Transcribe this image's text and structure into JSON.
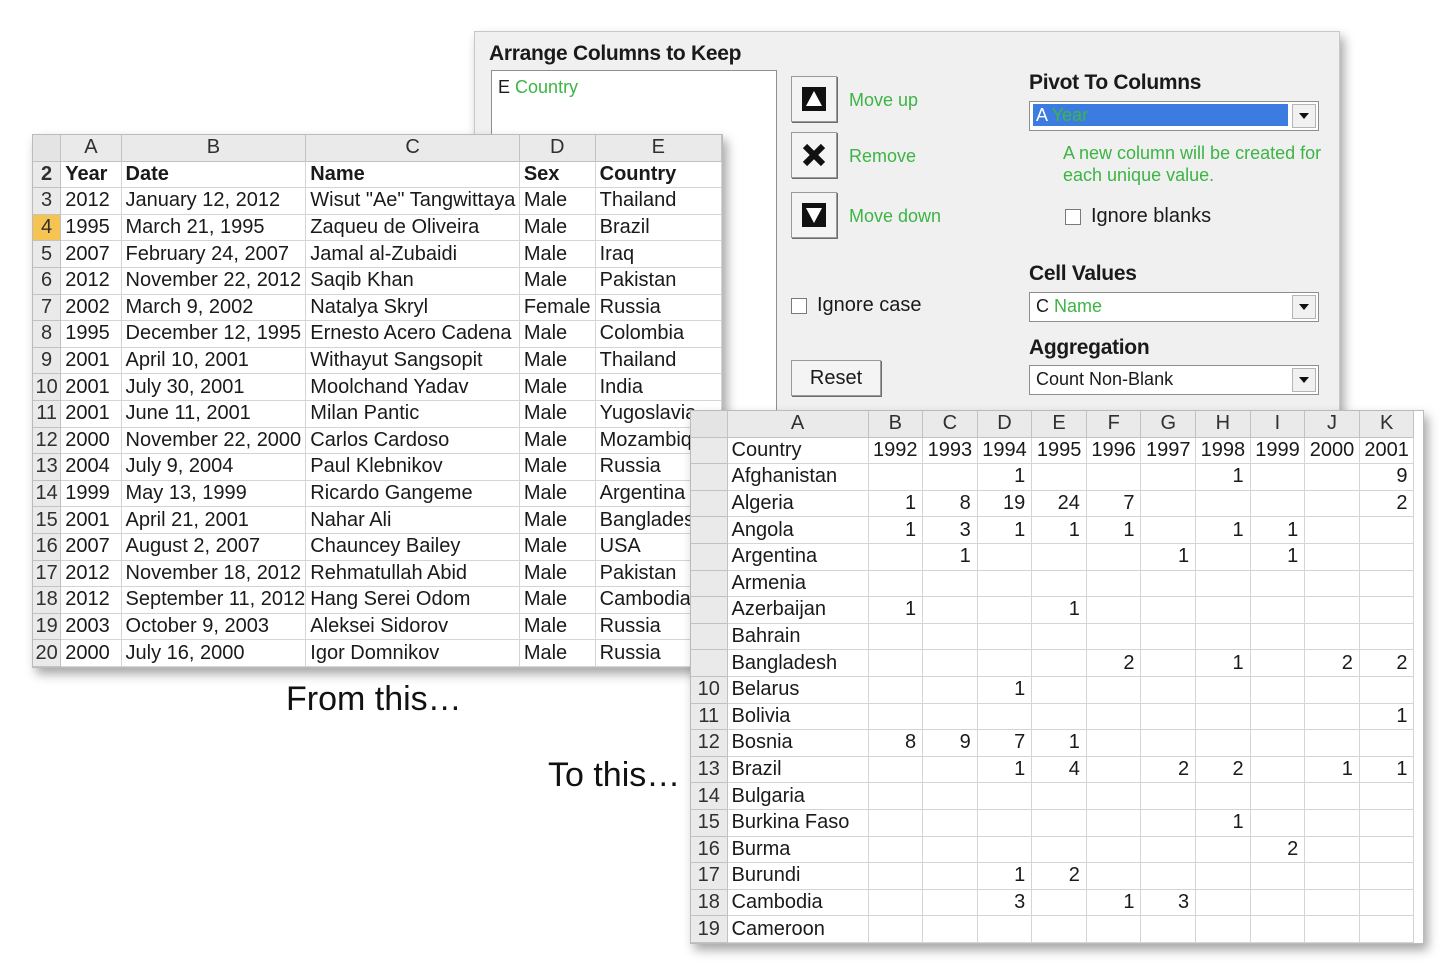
{
  "dialog": {
    "title": "Arrange Columns to Keep",
    "keep_columns": [
      {
        "letter": "E",
        "name": "Country"
      }
    ],
    "move_up_label": "Move up",
    "remove_label": "Remove",
    "move_down_label": "Move down",
    "ignore_case_label": "Ignore case",
    "reset_label": "Reset",
    "pivot_title": "Pivot To Columns",
    "pivot_letter": "A",
    "pivot_name": "Year",
    "pivot_note": "A new column will be created for each unique value.",
    "ignore_blanks_label": "Ignore blanks",
    "cell_values_title": "Cell Values",
    "cell_values_letter": "C",
    "cell_values_name": "Name",
    "aggregation_title": "Aggregation",
    "aggregation_value": "Count Non-Blank",
    "colors": {
      "field_name": "#3cb544",
      "selection": "#3c7be0"
    }
  },
  "source_sheet": {
    "columns": [
      "A",
      "B",
      "C",
      "D",
      "E"
    ],
    "header_row": "2",
    "headers": [
      "Year",
      "Date",
      "Name",
      "Sex",
      "Country"
    ],
    "active_row": "4",
    "rows": [
      [
        "3",
        "2012",
        "January 12, 2012",
        "Wisut \"Ae\" Tangwittaya",
        "Male",
        "Thailand"
      ],
      [
        "4",
        "1995",
        "March 21, 1995",
        "Zaqueu de Oliveira",
        "Male",
        "Brazil"
      ],
      [
        "5",
        "2007",
        "February 24, 2007",
        "Jamal al-Zubaidi",
        "Male",
        "Iraq"
      ],
      [
        "6",
        "2012",
        "November 22, 2012",
        "Saqib Khan",
        "Male",
        "Pakistan"
      ],
      [
        "7",
        "2002",
        "March  9, 2002",
        "Natalya Skryl",
        "Female",
        "Russia"
      ],
      [
        "8",
        "1995",
        "December 12, 1995",
        "Ernesto Acero Cadena",
        "Male",
        "Colombia"
      ],
      [
        "9",
        "2001",
        "April 10, 2001",
        "Withayut Sangsopit",
        "Male",
        "Thailand"
      ],
      [
        "10",
        "2001",
        "July 30, 2001",
        "Moolchand Yadav",
        "Male",
        "India"
      ],
      [
        "11",
        "2001",
        "June 11, 2001",
        "Milan Pantic",
        "Male",
        "Yugoslavia"
      ],
      [
        "12",
        "2000",
        "November 22, 2000",
        "Carlos Cardoso",
        "Male",
        "Mozambique"
      ],
      [
        "13",
        "2004",
        "July  9, 2004",
        "Paul Klebnikov",
        "Male",
        "Russia"
      ],
      [
        "14",
        "1999",
        "May 13, 1999",
        "Ricardo Gangeme",
        "Male",
        "Argentina"
      ],
      [
        "15",
        "2001",
        "April 21, 2001",
        "Nahar Ali",
        "Male",
        "Bangladesh"
      ],
      [
        "16",
        "2007",
        "August  2, 2007",
        "Chauncey Bailey",
        "Male",
        "USA"
      ],
      [
        "17",
        "2012",
        "November 18, 2012",
        "Rehmatullah Abid",
        "Male",
        "Pakistan"
      ],
      [
        "18",
        "2012",
        "September 11, 2012",
        "Hang Serei Odom",
        "Male",
        "Cambodia"
      ],
      [
        "19",
        "2003",
        "October 9, 2003",
        "Aleksei Sidorov",
        "Male",
        "Russia"
      ],
      [
        "20",
        "2000",
        "July 16, 2000",
        "Igor Domnikov",
        "Male",
        "Russia"
      ]
    ]
  },
  "result_sheet": {
    "columns": [
      "A",
      "B",
      "C",
      "D",
      "E",
      "F",
      "G",
      "H",
      "I",
      "J",
      "K"
    ],
    "header_label": "Country",
    "years": [
      "1992",
      "1993",
      "1994",
      "1995",
      "1996",
      "1997",
      "1998",
      "1999",
      "2000",
      "2001"
    ],
    "rows": [
      [
        "",
        "Afghanistan",
        "",
        "",
        "1",
        "",
        "",
        "",
        "1",
        "",
        "",
        "9"
      ],
      [
        "",
        "Algeria",
        "1",
        "8",
        "19",
        "24",
        "7",
        "",
        "",
        "",
        "",
        "2"
      ],
      [
        "",
        "Angola",
        "1",
        "3",
        "1",
        "1",
        "1",
        "",
        "1",
        "1",
        "",
        ""
      ],
      [
        "",
        "Argentina",
        "",
        "1",
        "",
        "",
        "",
        "1",
        "",
        "1",
        "",
        ""
      ],
      [
        "",
        "Armenia",
        "",
        "",
        "",
        "",
        "",
        "",
        "",
        "",
        "",
        ""
      ],
      [
        "",
        "Azerbaijan",
        "1",
        "",
        "",
        "1",
        "",
        "",
        "",
        "",
        "",
        ""
      ],
      [
        "",
        "Bahrain",
        "",
        "",
        "",
        "",
        "",
        "",
        "",
        "",
        "",
        ""
      ],
      [
        "",
        "Bangladesh",
        "",
        "",
        "",
        "",
        "2",
        "",
        "1",
        "",
        "2",
        "2"
      ],
      [
        "10",
        "Belarus",
        "",
        "",
        "1",
        "",
        "",
        "",
        "",
        "",
        "",
        ""
      ],
      [
        "11",
        "Bolivia",
        "",
        "",
        "",
        "",
        "",
        "",
        "",
        "",
        "",
        "1"
      ],
      [
        "12",
        "Bosnia",
        "8",
        "9",
        "7",
        "1",
        "",
        "",
        "",
        "",
        "",
        ""
      ],
      [
        "13",
        "Brazil",
        "",
        "",
        "1",
        "4",
        "",
        "2",
        "2",
        "",
        "1",
        "1"
      ],
      [
        "14",
        "Bulgaria",
        "",
        "",
        "",
        "",
        "",
        "",
        "",
        "",
        "",
        ""
      ],
      [
        "15",
        "Burkina Faso",
        "",
        "",
        "",
        "",
        "",
        "",
        "1",
        "",
        "",
        ""
      ],
      [
        "16",
        "Burma",
        "",
        "",
        "",
        "",
        "",
        "",
        "",
        "2",
        "",
        ""
      ],
      [
        "17",
        "Burundi",
        "",
        "",
        "1",
        "2",
        "",
        "",
        "",
        "",
        "",
        ""
      ],
      [
        "18",
        "Cambodia",
        "",
        "",
        "3",
        "",
        "1",
        "3",
        "",
        "",
        "",
        ""
      ],
      [
        "19",
        "Cameroon",
        "",
        "",
        "",
        "",
        "",
        "",
        "",
        "",
        "",
        ""
      ]
    ]
  },
  "captions": {
    "from": "From this…",
    "to": "To this…"
  }
}
